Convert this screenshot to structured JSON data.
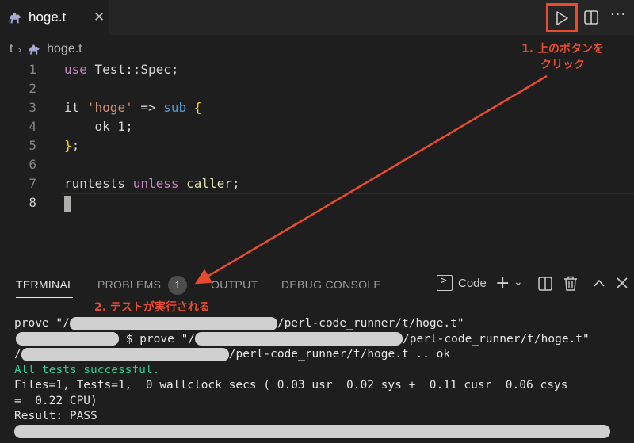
{
  "tab": {
    "label": "hoge.t",
    "close": "✕"
  },
  "toolbar": {
    "more": "···"
  },
  "breadcrumb": {
    "folder": "t",
    "separator": "›",
    "file": "hoge.t"
  },
  "annotations": {
    "step1_line1": "1. 上のボタンを",
    "step1_line2": "クリック",
    "step2": "2. テストが実行される"
  },
  "editor": {
    "line_numbers": [
      "1",
      "2",
      "3",
      "4",
      "5",
      "6",
      "7",
      "8"
    ],
    "active_line": "8"
  },
  "panel": {
    "tabs": [
      "TERMINAL",
      "PROBLEMS",
      "OUTPUT",
      "DEBUG CONSOLE"
    ],
    "problems_count": "1",
    "terminal_name": "Code",
    "add": "+",
    "chevron": "⌄"
  },
  "terminal": {
    "l1a": "prove \"/",
    "l1b": "/perl-code_runner/t/hoge.t\"",
    "l2a": " $ prove \"/",
    "l2b": "/perl-code_runner/t/hoge.t\"",
    "l3a": "/",
    "l3b": "/perl-code_runner/t/hoge.t .. ok",
    "l4": "All tests successful.",
    "l5": "Files=1, Tests=1,  0 wallclock secs ( 0.03 usr  0.02 sys +  0.11 cusr  0.06 csys",
    "l6": "=  0.22 CPU)",
    "l7": "Result: PASS"
  },
  "colors": {
    "accent": "#e84b2e",
    "success": "#23d18b",
    "keyword": "#c586c0",
    "string": "#ce9178"
  }
}
